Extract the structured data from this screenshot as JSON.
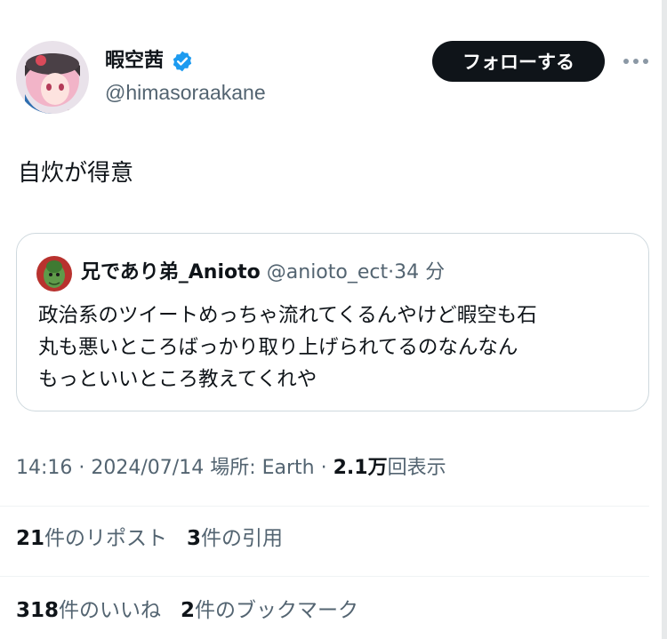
{
  "author": {
    "display_name": "暇空茜",
    "handle": "@himasoraakane",
    "verified": true,
    "avatar": "anime-girl-avatar"
  },
  "actions": {
    "follow_label": "フォローする",
    "more_icon": "ellipsis-icon"
  },
  "tweet": {
    "text": "自炊が得意"
  },
  "quote": {
    "display_name": "兄であり弟_Anioto",
    "handle": "@anioto_ect",
    "separator": "·",
    "time": "34 分",
    "avatar": "green-character-avatar",
    "lines": [
      "政治系のツイートめっちゃ流れてくるんやけど暇空も石",
      "丸も悪いところばっかり取り上げられてるのなんなん",
      "もっといいところ教えてくれや"
    ]
  },
  "meta": {
    "time": "14:16",
    "separator": "·",
    "date": "2024/07/14",
    "location_label": "場所: Earth",
    "views_count": "2.1万",
    "views_label": "回表示"
  },
  "stats": {
    "reposts_count": "21",
    "reposts_label": "件のリポスト",
    "quotes_count": "3",
    "quotes_label": "件の引用",
    "likes_count": "318",
    "likes_label": "件のいいね",
    "bookmarks_count": "2",
    "bookmarks_label": "件のブックマーク"
  },
  "colors": {
    "text_primary": "#0f1419",
    "text_secondary": "#536471",
    "verified_blue": "#1d9bf0",
    "border": "#cfd9de",
    "follow_bg": "#0f1419"
  }
}
